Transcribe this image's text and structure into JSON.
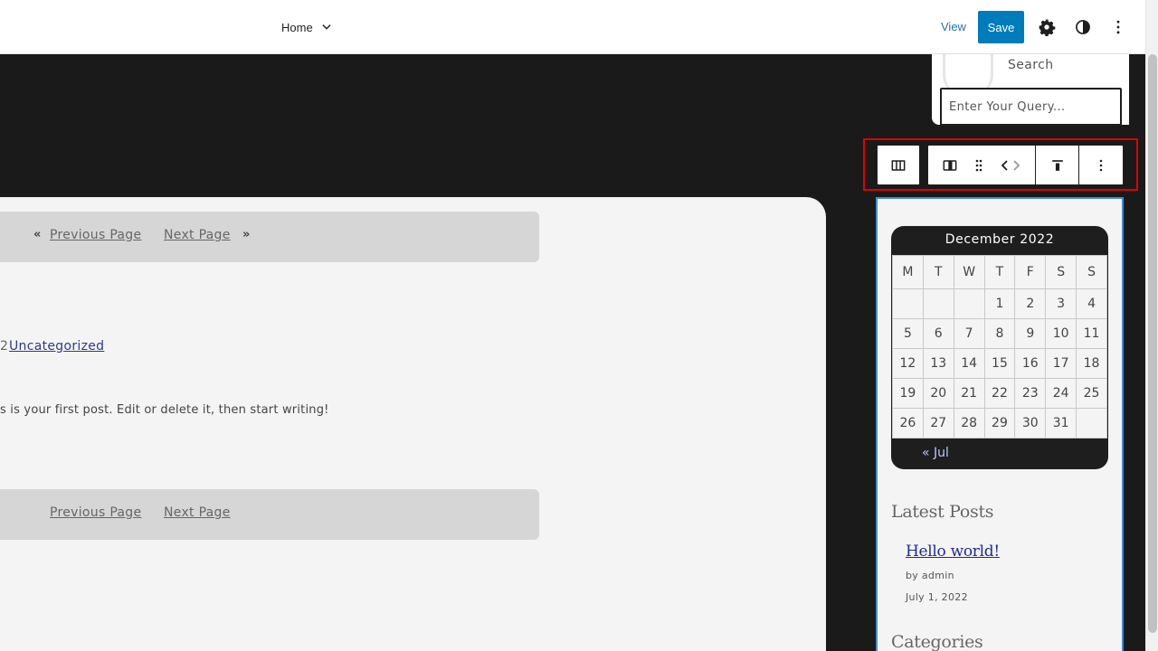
{
  "header": {
    "nav_label": "Home",
    "view_label": "View",
    "save_label": "Save"
  },
  "pagination_top": {
    "prev_label": "Previous Page",
    "next_label": "Next Page"
  },
  "pagination_bottom": {
    "prev_label": "Previous Page",
    "next_label": "Next Page"
  },
  "post": {
    "category_prefix": "2",
    "category": "Uncategorized",
    "excerpt": "s is your first post. Edit or delete it, then start writing!"
  },
  "search": {
    "label": "Search",
    "placeholder": "Enter Your Query..."
  },
  "calendar": {
    "caption": "December 2022",
    "weekdays": [
      "M",
      "T",
      "W",
      "T",
      "F",
      "S",
      "S"
    ],
    "weeks": [
      [
        "",
        "",
        "",
        "1",
        "2",
        "3",
        "4"
      ],
      [
        "5",
        "6",
        "7",
        "8",
        "9",
        "10",
        "11"
      ],
      [
        "12",
        "13",
        "14",
        "15",
        "16",
        "17",
        "18"
      ],
      [
        "19",
        "20",
        "21",
        "22",
        "23",
        "24",
        "25"
      ],
      [
        "26",
        "27",
        "28",
        "29",
        "30",
        "31",
        ""
      ]
    ],
    "prev_label": "« Jul"
  },
  "latest_posts": {
    "heading": "Latest Posts",
    "items": [
      {
        "title": "Hello world!",
        "author": "by admin",
        "date": "July 1, 2022"
      }
    ]
  },
  "categories": {
    "heading": "Categories"
  },
  "icons": {
    "nav_dropdown": "chevron-down-icon",
    "settings": "gear-icon",
    "styles": "contrast-icon",
    "options": "more-vertical-icon",
    "parent_block": "columns-icon",
    "block_type": "column-icon",
    "drag": "drag-handle-icon",
    "move": "arrows-left-right-icon",
    "align": "align-top-icon",
    "block_options": "more-vertical-icon"
  },
  "colors": {
    "accent": "#007cba",
    "highlight": "#e00000",
    "selection": "#3a8fd6"
  }
}
